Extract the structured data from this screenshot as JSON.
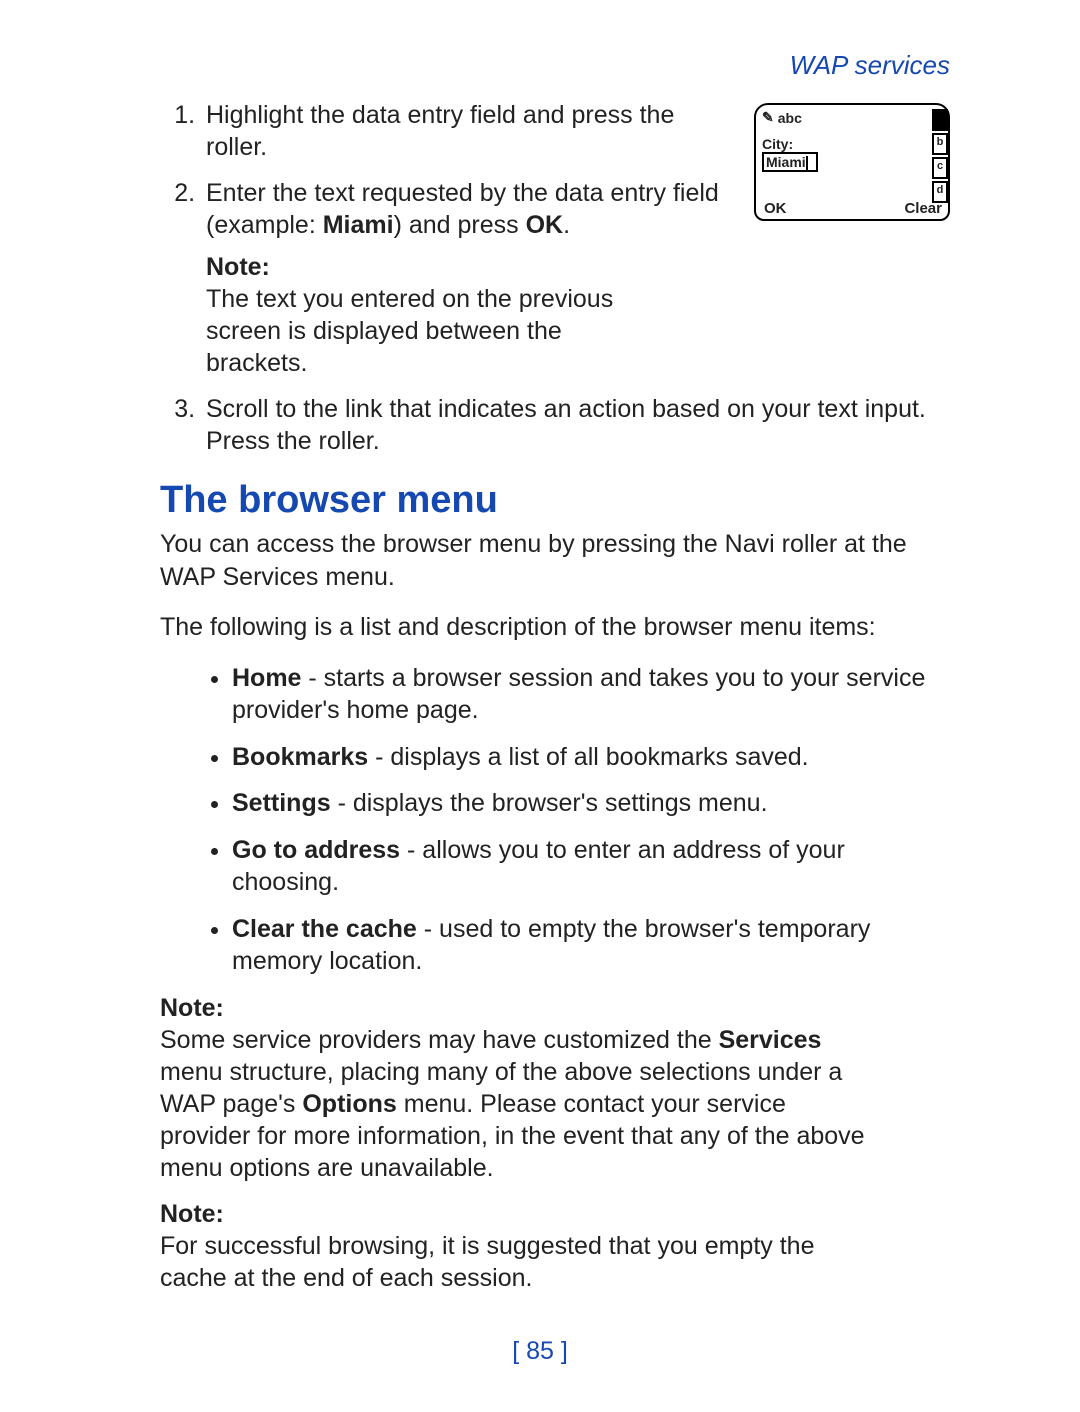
{
  "header": {
    "section_label": "WAP services"
  },
  "steps": {
    "s1": "Highlight the data entry field and press the roller.",
    "s2_pre": "Enter the text requested by the data entry field (example: ",
    "s2_bold1": "Miami",
    "s2_mid": ") and press ",
    "s2_bold2": "OK",
    "s2_post": ".",
    "note1_label": "Note:",
    "note1_body": "The text you entered on the previous screen is displayed between the brackets.",
    "s3": "Scroll to the link that indicates an action based on your text input. Press the roller."
  },
  "phone": {
    "mode": "abc",
    "city_label": "City:",
    "input_value": "Miami",
    "scroll_letters": [
      "a",
      "b",
      "c",
      "d"
    ],
    "softkey_left": "OK",
    "softkey_right": "Clear"
  },
  "section": {
    "title": "The browser menu",
    "intro1": "You can access the browser menu by pressing the Navi roller at the WAP Services menu.",
    "intro2": "The following is a list and description of the browser menu items:"
  },
  "bullets": {
    "home_label": "Home",
    "home_text": " - starts a browser session and takes you to your service provider's home page.",
    "bookmarks_label": "Bookmarks",
    "bookmarks_text": " - displays a list of all bookmarks saved.",
    "settings_label": "Settings",
    "settings_text": " - displays the browser's settings menu.",
    "goto_label": "Go to address",
    "goto_text": " - allows you to enter an address of your choosing.",
    "clear_label": "Clear the cache",
    "clear_text": " - used to empty the browser's temporary memory location."
  },
  "notes": {
    "label": "Note:",
    "n2_pre": "Some service providers may have customized the ",
    "n2_b1": "Services",
    "n2_mid": " menu structure, placing many of the above selections under a WAP page's ",
    "n2_b2": "Options",
    "n2_post": " menu. Please contact your service provider for more information, in the event that any of the above menu options are unavailable.",
    "n3": "For successful browsing, it is suggested that you empty the cache at the end of each session."
  },
  "page_number": "[ 85 ]"
}
